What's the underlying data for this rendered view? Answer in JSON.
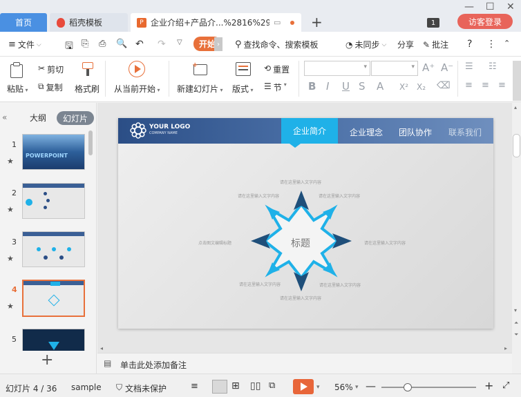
{
  "tabs": {
    "home": "首页",
    "template": "稻壳模板",
    "document": "企业介绍+产品介...%2816%29"
  },
  "window": {
    "visitor_login": "访客登录",
    "page_badge": "1"
  },
  "menu": {
    "file": "文件",
    "start": "开始",
    "search": "查找命令、搜索模板",
    "unsync": "未同步",
    "share": "分享",
    "comment": "批注",
    "help": "?"
  },
  "ribbon": {
    "paste": "粘贴",
    "cut": "剪切",
    "copy": "复制",
    "format_painter": "格式刷",
    "play_from_current": "从当前开始",
    "new_slide": "新建幻灯片",
    "layout": "版式",
    "reset": "重置",
    "section": "节"
  },
  "left_panel": {
    "outline_tab": "大纲",
    "slides_tab": "幻灯片",
    "slides": [
      {
        "num": "1",
        "title": "POWERPOINT"
      },
      {
        "num": "2"
      },
      {
        "num": "3"
      },
      {
        "num": "4"
      },
      {
        "num": "5"
      }
    ]
  },
  "slide": {
    "logo_title": "YOUR LOGO",
    "logo_sub": "COMPANY NAME",
    "nav": [
      "企业简介",
      "企业理念",
      "团队协作",
      "联系我们"
    ],
    "center_title": "标题",
    "placeholders": {
      "top": "请在这里输入文字内容",
      "top_left": "请在这里输入文字内容",
      "top_right": "请在这里输入文字内容",
      "left": "点击图文编辑标题",
      "right": "请在这里输入文字内容",
      "bottom_left": "请在这里输入文字内容",
      "bottom_right": "请在这里输入文字内容",
      "bottom": "请在这里输入文字内容"
    }
  },
  "notes": {
    "placeholder": "单击此处添加备注"
  },
  "status": {
    "slide_info": "幻灯片 4 / 36",
    "theme": "sample",
    "protect": "文档未保护",
    "zoom": "56%"
  },
  "colors": {
    "accent_orange": "#e8703a",
    "home_tab": "#4a90e2",
    "slide_nav_active": "#1fb1e8",
    "star_dark": "#1f4f7a",
    "star_light": "#1fb1e8"
  }
}
